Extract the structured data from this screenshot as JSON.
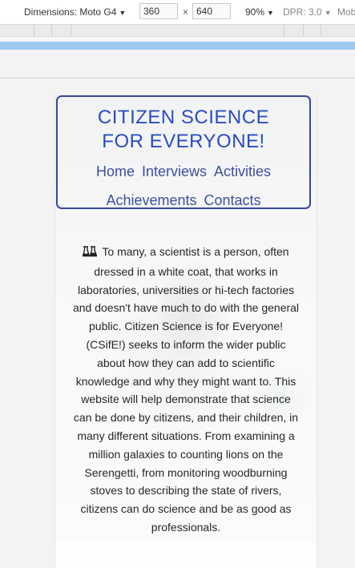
{
  "devtools": {
    "device_label": "Dimensions: Moto G4",
    "width": "360",
    "times": "×",
    "height": "640",
    "zoom": "90%",
    "dpr": "DPR: 3.0",
    "mobile": "Mob"
  },
  "site": {
    "title_line1": "CITIZEN SCIENCE",
    "title_line2": "FOR EVERYONE!",
    "nav": [
      "Home",
      "Interviews",
      "Activities",
      "Achievements",
      "Contacts"
    ],
    "intro": "To many, a scientist is a person, often dressed in a white coat, that works in laboratories, universities or hi-tech factories and doesn't have much to do with the general public. Citizen Science is for Everyone! (CSifE!) seeks to inform the wider public about how they can add to scientific knowledge and why they might want to. This website will help demonstrate that science can be done by citizens, and their children, in many different situations. From examining a million galaxies to counting lions on the Serengetti, from monitoring woodburning stoves to describing the state of rivers, citizens can do science and be as good as professionals."
  },
  "colors": {
    "title": "#2b4cc0",
    "nav": "#3b52a0",
    "border": "#32499a",
    "mq_blue": "#9ec8ee"
  }
}
